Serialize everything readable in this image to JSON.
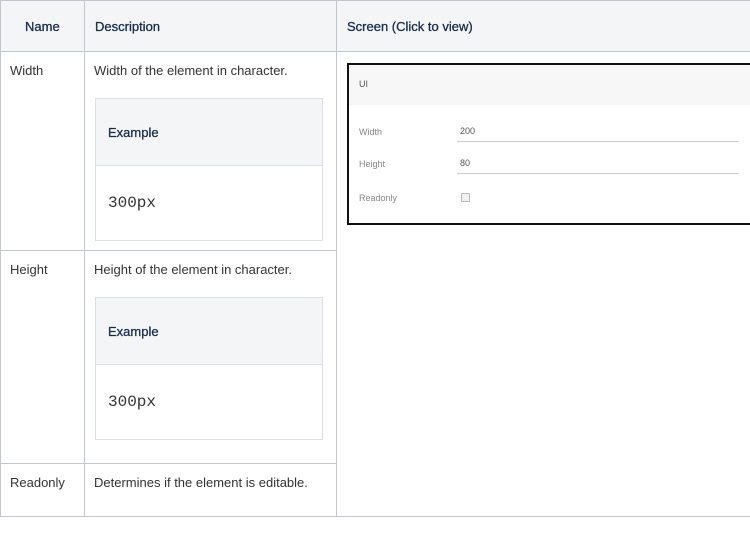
{
  "table": {
    "headers": [
      "Name",
      "Description",
      "Screen (Click to view)"
    ],
    "rows": [
      {
        "name": "Width",
        "description": "Width of the element in character.",
        "example_title": "Example",
        "example_value": "300px"
      },
      {
        "name": "Height",
        "description": "Height of the element in character.",
        "example_title": "Example",
        "example_value": "300px"
      },
      {
        "name": "Readonly",
        "description": "Determines if the element is editable."
      }
    ]
  },
  "screenshot": {
    "section_title": "UI",
    "fields": [
      {
        "label": "Width",
        "value": "200"
      },
      {
        "label": "Height",
        "value": "80"
      },
      {
        "label": "Readonly"
      }
    ]
  }
}
